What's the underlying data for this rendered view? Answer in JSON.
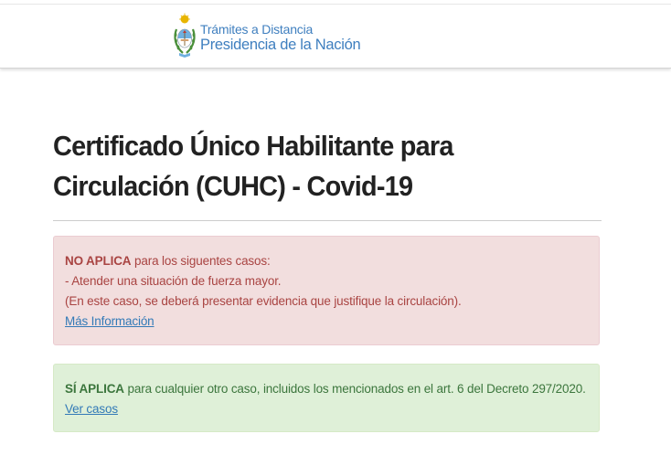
{
  "header": {
    "brand_line1": "Trámites a Distancia",
    "brand_line2": "Presidencia de la Nación",
    "seal_icon": "argentina-coat-of-arms-icon"
  },
  "page": {
    "title_line1": "Certificado Único Habilitante para",
    "title_line2": "Circulación (CUHC) - Covid-19"
  },
  "alert_no": {
    "strong": "NO APLICA",
    "intro": " para los siguentes casos:",
    "line2": "- Atender una situación de fuerza mayor.",
    "line3": "(En este caso, se deberá presentar evidencia que justifique la circulación).",
    "link": "Más Información"
  },
  "alert_si": {
    "strong": "SÍ APLICA",
    "text": " para cualquier otro caso, incluidos los mencionados en el art. 6 del Decreto 297/2020.",
    "link": "Ver casos"
  },
  "colors": {
    "brand": "#3f7fbf",
    "danger_bg": "#f2dede",
    "danger_text": "#a94442",
    "success_bg": "#dff0d8",
    "success_text": "#3c763d",
    "link": "#337ab7"
  }
}
